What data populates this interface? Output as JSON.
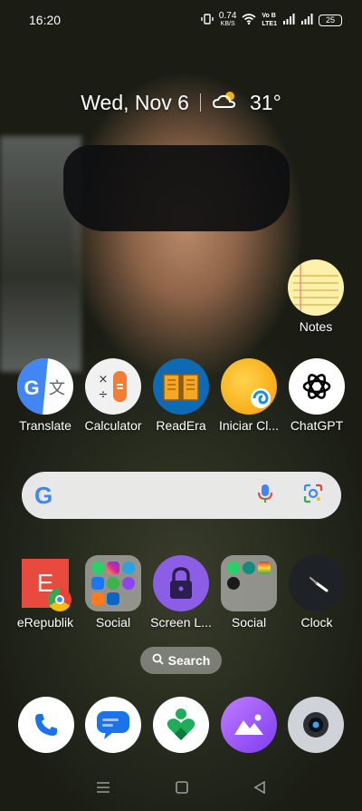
{
  "status_bar": {
    "time": "16:20",
    "net_speed_value": "0.74",
    "net_speed_unit": "KB/S",
    "volte_top": "Vo B",
    "volte_bottom": "LTE1",
    "battery": "25"
  },
  "header": {
    "date": "Wed, Nov 6",
    "temperature": "31°",
    "weather_icon": "partly-cloudy-icon"
  },
  "widgets": {
    "notes_label": "Notes"
  },
  "apps_row_1": [
    {
      "label": "Translate"
    },
    {
      "label": "Calculator"
    },
    {
      "label": "ReadEra"
    },
    {
      "label": "Iniciar Cl..."
    },
    {
      "label": "ChatGPT"
    }
  ],
  "google_search": {
    "logo": "G"
  },
  "apps_row_2": [
    {
      "label": "eRepublik",
      "letter": "E"
    },
    {
      "label": "Social"
    },
    {
      "label": "Screen L..."
    },
    {
      "label": "Social"
    },
    {
      "label": "Clock"
    }
  ],
  "search_pill": {
    "label": "Search"
  },
  "dock": [
    "phone-icon",
    "messages-icon",
    "app-heart-icon",
    "gallery-icon",
    "camera-icon"
  ],
  "colors": {
    "accent_blue": "#1a73e8",
    "calculator_orange": "#f47d34",
    "readera_blue": "#0e6ab3",
    "screen_lock_purple": "#8c5ee6",
    "gallery_purple": "#a35cf0"
  }
}
